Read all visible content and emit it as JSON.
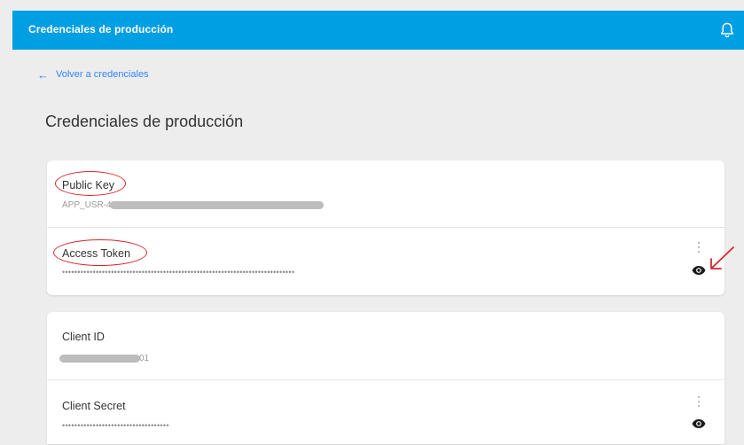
{
  "header": {
    "title": "Credenciales de producción",
    "bell_icon": "bell-icon",
    "bg_color": "#009ee3"
  },
  "back_link": {
    "label": "Volver a credenciales",
    "arrow_icon": "arrow-left-icon"
  },
  "page": {
    "title": "Credenciales de producción"
  },
  "card1": {
    "public_key": {
      "label": "Public Key",
      "value_prefix": "APP_USR-4a"
    },
    "access_token": {
      "label": "Access Token",
      "masked": "••••••••••••••••••••••••••••••••••••••••••••••••••••••••••••••••••••••••••••"
    }
  },
  "card2": {
    "client_id": {
      "label": "Client ID",
      "value_suffix": "01"
    },
    "client_secret": {
      "label": "Client Secret",
      "masked": "•••••••••••••••••••••••••••••••••••"
    }
  },
  "annotation_color": "#d7262e"
}
